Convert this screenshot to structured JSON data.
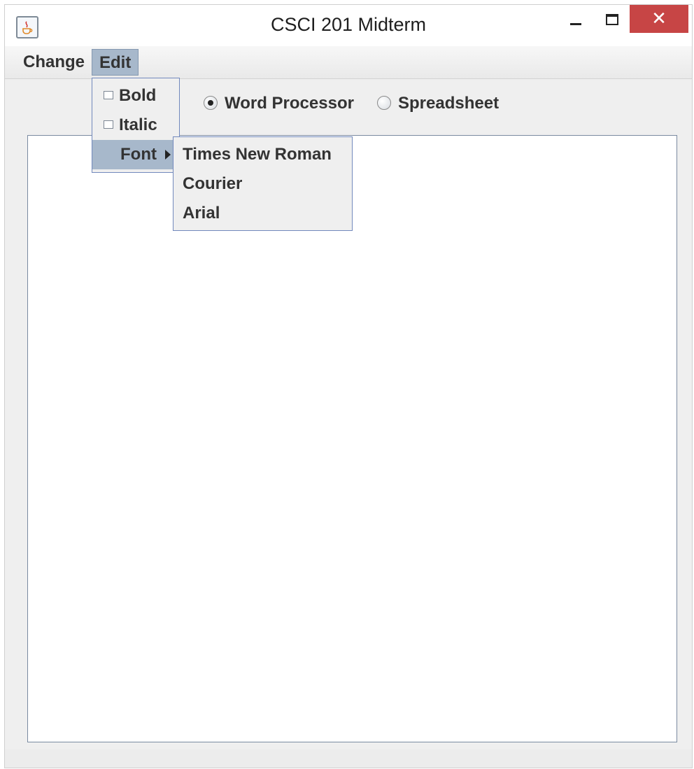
{
  "window": {
    "title": "CSCI 201 Midterm",
    "close_glyph": "✕",
    "icon": "java-cup-icon"
  },
  "menubar": {
    "items": [
      {
        "label": "Change"
      },
      {
        "label": "Edit"
      }
    ]
  },
  "edit_menu": {
    "bold_label": "Bold",
    "bold_checked": false,
    "italic_label": "Italic",
    "italic_checked": false,
    "font_label": "Font"
  },
  "font_menu": {
    "options": [
      "Times New Roman",
      "Courier",
      "Arial"
    ]
  },
  "mode": {
    "word_processor_label": "Word Processor",
    "spreadsheet_label": "Spreadsheet",
    "selected": "Word Processor"
  },
  "editor": {
    "content": ""
  },
  "colors": {
    "menu_highlight": "#a7b8cb",
    "close_button": "#c74545",
    "popup_border": "#7289bd"
  }
}
